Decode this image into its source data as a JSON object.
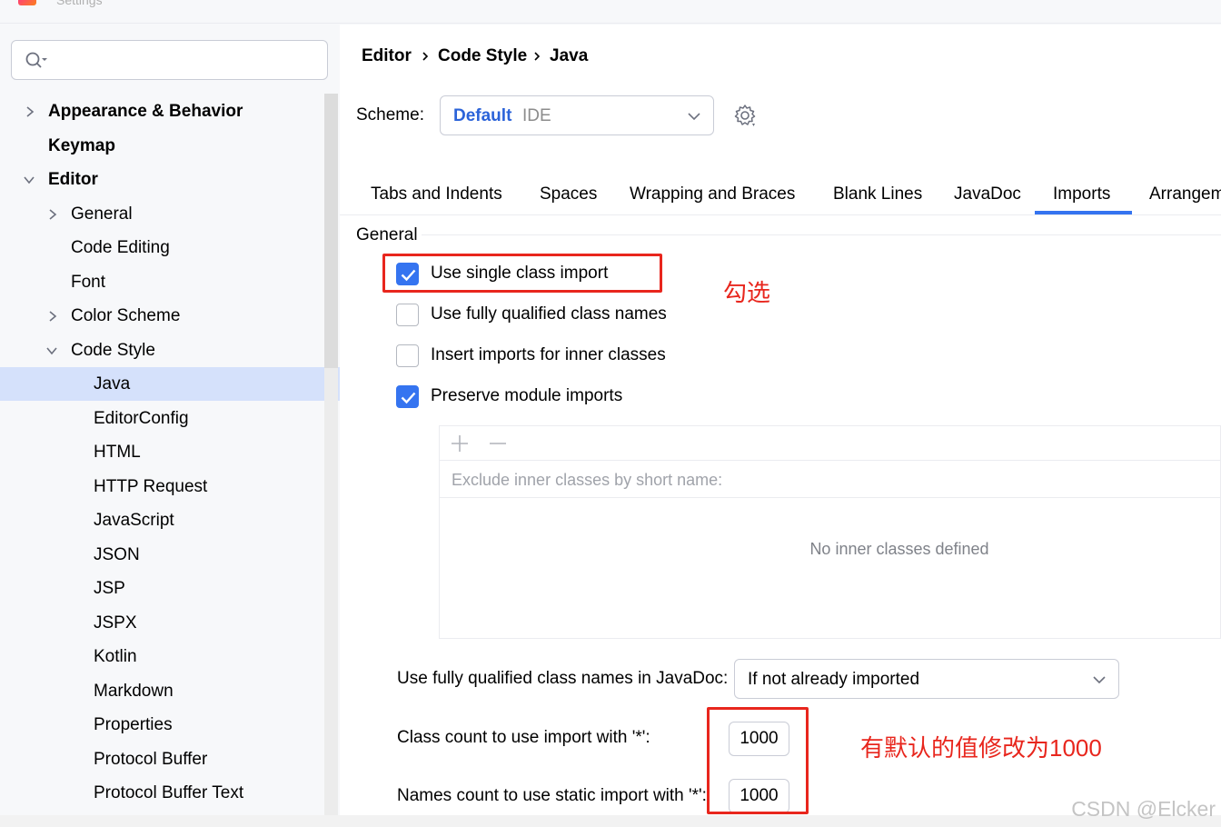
{
  "window": {
    "title": "Settings"
  },
  "search": {
    "placeholder": ""
  },
  "sidebar": {
    "items": [
      {
        "label": "Appearance & Behavior"
      },
      {
        "label": "Keymap"
      },
      {
        "label": "Editor"
      },
      {
        "label": "General"
      },
      {
        "label": "Code Editing"
      },
      {
        "label": "Font"
      },
      {
        "label": "Color Scheme"
      },
      {
        "label": "Code Style"
      },
      {
        "label": "Java"
      },
      {
        "label": "EditorConfig"
      },
      {
        "label": "HTML"
      },
      {
        "label": "HTTP Request"
      },
      {
        "label": "JavaScript"
      },
      {
        "label": "JSON"
      },
      {
        "label": "JSP"
      },
      {
        "label": "JSPX"
      },
      {
        "label": "Kotlin"
      },
      {
        "label": "Markdown"
      },
      {
        "label": "Properties"
      },
      {
        "label": "Protocol Buffer"
      },
      {
        "label": "Protocol Buffer Text"
      }
    ]
  },
  "breadcrumb": [
    "Editor",
    "Code Style",
    "Java"
  ],
  "scheme": {
    "label": "Scheme:",
    "name": "Default",
    "type": "IDE"
  },
  "tabs": [
    "Tabs and Indents",
    "Spaces",
    "Wrapping and Braces",
    "Blank Lines",
    "JavaDoc",
    "Imports",
    "Arrangem"
  ],
  "active_tab": "Imports",
  "general": {
    "section": "General",
    "options": [
      {
        "label": "Use single class import",
        "checked": true
      },
      {
        "label": "Use fully qualified class names",
        "checked": false
      },
      {
        "label": "Insert imports for inner classes",
        "checked": false
      },
      {
        "label": "Preserve module imports",
        "checked": true
      }
    ]
  },
  "inner_classes": {
    "header": "Exclude inner classes by short name:",
    "empty": "No inner classes defined"
  },
  "javadoc": {
    "label": "Use fully qualified class names in JavaDoc:",
    "value": "If not already imported"
  },
  "class_count": {
    "label": "Class count to use import with '*':",
    "value": "1000"
  },
  "names_count": {
    "label": "Names count to use static import with '*':",
    "value": "1000"
  },
  "annotations": {
    "check": "勾选",
    "modify": "有默认的值修改为1000"
  },
  "watermark": "CSDN @Elcker",
  "colors": {
    "accent": "#3574f0",
    "annotation": "#e8261d",
    "selection": "#d5e1fb"
  }
}
